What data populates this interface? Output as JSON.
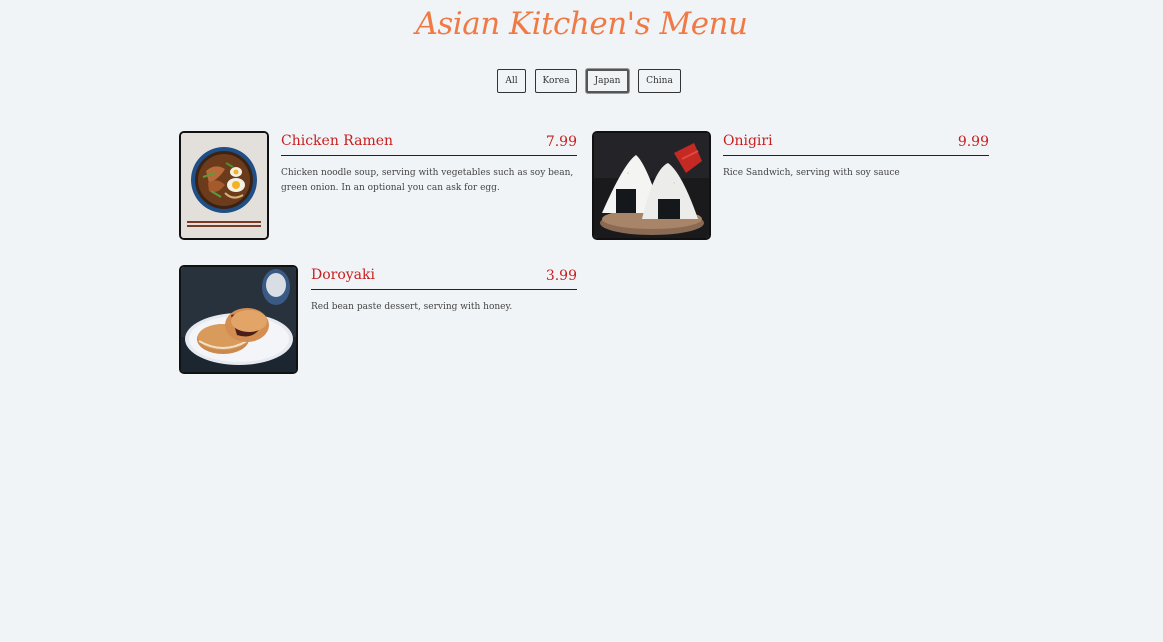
{
  "page": {
    "title": "Asian Kitchen's Menu"
  },
  "filters": [
    {
      "label": "All",
      "active": false
    },
    {
      "label": "Korea",
      "active": false
    },
    {
      "label": "Japan",
      "active": true
    },
    {
      "label": "China",
      "active": false
    }
  ],
  "menu": [
    {
      "name": "Chicken Ramen",
      "price": "7.99",
      "description": "Chicken noodle soup, serving with vegetables such as soy bean, green onion. In an optional you can ask for egg.",
      "image": "ramen-bowl-photo"
    },
    {
      "name": "Onigiri",
      "price": "9.99",
      "description": "Rice Sandwich, serving with soy sauce",
      "image": "onigiri-photo"
    },
    {
      "name": "Doroyaki",
      "price": "3.99",
      "description": "Red bean paste dessert, serving with honey.",
      "image": "dorayaki-photo"
    }
  ],
  "colors": {
    "accent_title": "#f07a45",
    "accent_item": "#c81e1e",
    "background": "#f1f4f7"
  }
}
